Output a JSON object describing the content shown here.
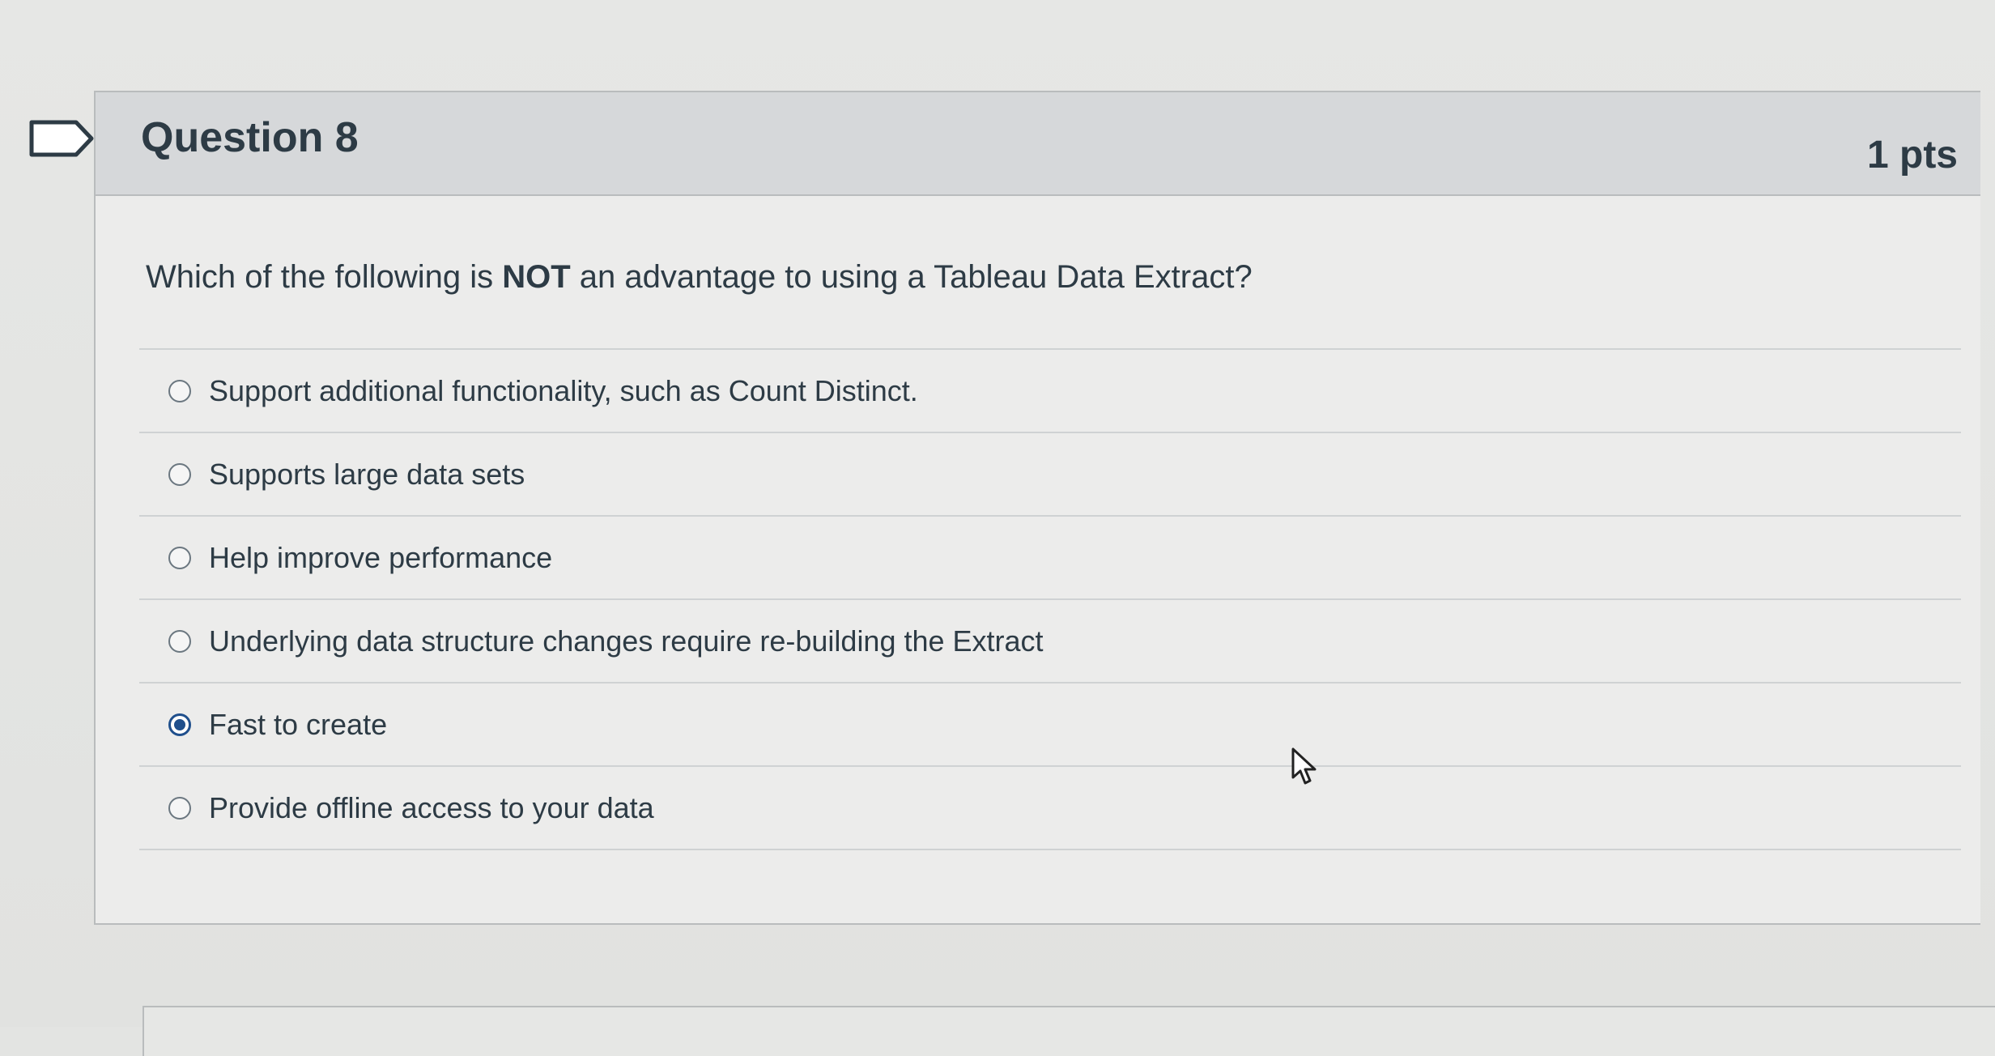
{
  "question": {
    "title": "Question 8",
    "points": "1 pts",
    "text_before": "Which of the following is ",
    "text_emphasis": "NOT",
    "text_after": " an advantage to using a Tableau Data Extract?",
    "flag_icon": "flag-outline-icon"
  },
  "answers": [
    {
      "label": "Support additional functionality, such as Count Distinct.",
      "selected": false
    },
    {
      "label": "Supports large data sets",
      "selected": false
    },
    {
      "label": "Help improve performance",
      "selected": false
    },
    {
      "label": "Underlying data structure changes require re-building the Extract",
      "selected": false
    },
    {
      "label": "Fast to create",
      "selected": true
    },
    {
      "label": "Provide offline access to your data",
      "selected": false
    }
  ],
  "colors": {
    "header_bg": "#d6d8da",
    "text": "#2d3b45",
    "radio_selected": "#1f4f8c"
  }
}
